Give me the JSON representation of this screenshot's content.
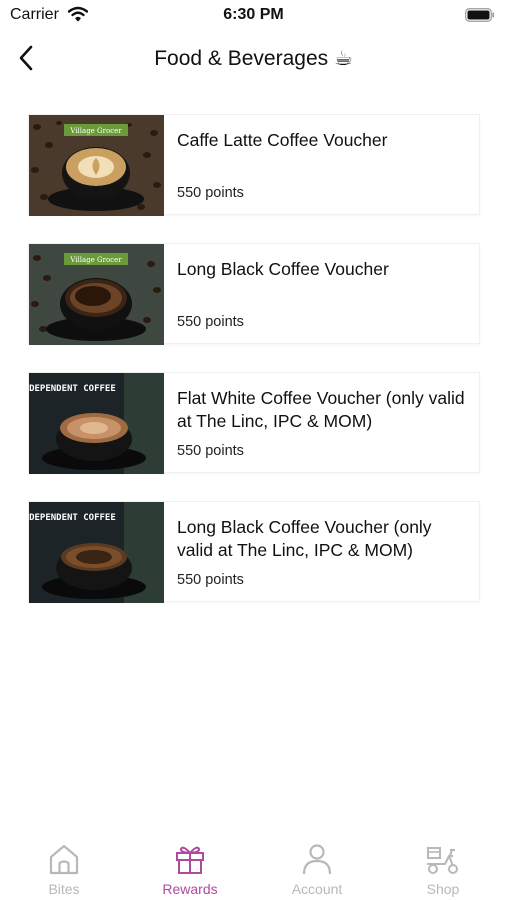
{
  "status_bar": {
    "carrier": "Carrier",
    "time": "6:30 PM"
  },
  "header": {
    "title": "Food & Beverages ☕",
    "back_icon": "chevron-left-icon"
  },
  "vouchers": [
    {
      "name": "Caffe Latte Coffee Voucher",
      "points": "550 points",
      "brand_logo": "Village Grocer"
    },
    {
      "name": "Long Black Coffee Voucher",
      "points": "550 points",
      "brand_logo": "Village Grocer"
    },
    {
      "name": "Flat White Coffee Voucher (only valid at The Linc, IPC & MOM)",
      "points": "550 points",
      "brand_logo": "INDEPENDENT COFFEE"
    },
    {
      "name": "Long Black Coffee Voucher (only valid at The Linc, IPC & MOM)",
      "points": "550 points",
      "brand_logo": "INDEPENDENT COFFEE"
    }
  ],
  "tabs": [
    {
      "label": "Bites",
      "icon": "home-icon",
      "active": false
    },
    {
      "label": "Rewards",
      "icon": "gift-icon",
      "active": true
    },
    {
      "label": "Account",
      "icon": "person-icon",
      "active": false
    },
    {
      "label": "Shop",
      "icon": "scooter-icon",
      "active": false
    }
  ],
  "colors": {
    "active_tab": "#b04a9e",
    "inactive_tab": "#b8b8b8"
  }
}
